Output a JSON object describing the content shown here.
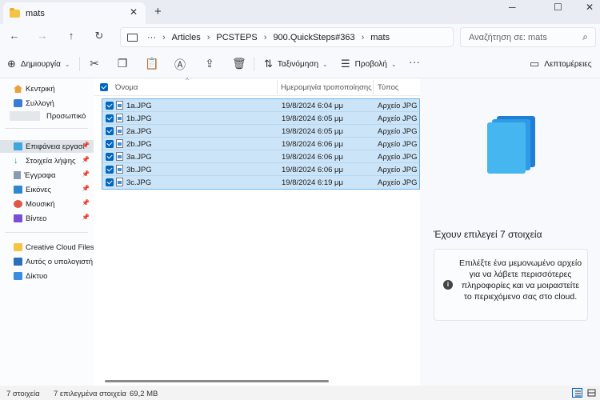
{
  "window": {
    "tab_title": "mats",
    "close_tab_glyph": "✕",
    "new_tab_glyph": "+",
    "minimize_glyph": "─",
    "maximize_glyph": "☐",
    "close_window_glyph": "✕"
  },
  "nav": {
    "back_glyph": "←",
    "forward_glyph": "→",
    "up_glyph": "↑",
    "refresh_glyph": "↻",
    "more_glyph": "···",
    "breadcrumb": [
      "Articles",
      "PCSTEPS",
      "900.QuickSteps#363",
      "mats"
    ],
    "separator": "›",
    "search_placeholder": "Αναζήτηση σε: mats",
    "search_icon": "search-icon"
  },
  "toolbar": {
    "new_label": "Δημιουργία",
    "sort_label": "Ταξινόμηση",
    "view_label": "Προβολή",
    "more_label": "···",
    "details_label": "Λεπτομέρειες",
    "icons": [
      "cut-icon",
      "copy-icon",
      "paste-icon",
      "rename-icon",
      "share-icon",
      "delete-icon"
    ]
  },
  "sidebar": {
    "items": [
      {
        "label": "Κεντρική",
        "icon": "home-icon",
        "pinned": false
      },
      {
        "label": "Συλλογή",
        "icon": "gallery-icon",
        "pinned": false
      },
      {
        "label": "Προσωπικό",
        "icon": "onedrive-icon",
        "pinned": false
      },
      {
        "label": "Επιφάνεια εργασί",
        "icon": "desktop-icon",
        "pinned": true
      },
      {
        "label": "Στοιχεία λήψης",
        "icon": "downloads-icon",
        "pinned": true
      },
      {
        "label": "Έγγραφα",
        "icon": "documents-icon",
        "pinned": true
      },
      {
        "label": "Εικόνες",
        "icon": "pictures-icon",
        "pinned": true
      },
      {
        "label": "Μουσική",
        "icon": "music-icon",
        "pinned": true
      },
      {
        "label": "Βίντεο",
        "icon": "videos-icon",
        "pinned": true
      },
      {
        "label": "Creative Cloud Files P",
        "icon": "creative-cloud-icon",
        "pinned": false
      },
      {
        "label": "Αυτός ο υπολογιστή",
        "icon": "this-pc-icon",
        "pinned": false
      },
      {
        "label": "Δίκτυο",
        "icon": "network-icon",
        "pinned": false
      }
    ],
    "pin_glyph": "📌"
  },
  "filelist": {
    "columns": {
      "name": "Όνομα",
      "date": "Ημερομηνία τροποποίησης",
      "type": "Τύπος"
    },
    "sort_glyph": "^",
    "rows": [
      {
        "name": "1a.JPG",
        "date": "19/8/2024 6:04 μμ",
        "type": "Αρχείο JPG"
      },
      {
        "name": "1b.JPG",
        "date": "19/8/2024 6:05 μμ",
        "type": "Αρχείο JPG"
      },
      {
        "name": "2a.JPG",
        "date": "19/8/2024 6:05 μμ",
        "type": "Αρχείο JPG"
      },
      {
        "name": "2b.JPG",
        "date": "19/8/2024 6:06 μμ",
        "type": "Αρχείο JPG"
      },
      {
        "name": "3a.JPG",
        "date": "19/8/2024 6:06 μμ",
        "type": "Αρχείο JPG"
      },
      {
        "name": "3b.JPG",
        "date": "19/8/2024 6:06 μμ",
        "type": "Αρχείο JPG"
      },
      {
        "name": "3c.JPG",
        "date": "19/8/2024 6:19 μμ",
        "type": "Αρχείο JPG"
      }
    ]
  },
  "details": {
    "selection_title": "Έχουν επιλεγεί 7 στοιχεία",
    "info_text": "Επιλέξτε ένα μεμονωμένο αρχείο για να λάβετε περισσότερες πληροφορίες και να μοιραστείτε το περιεχόμενο σας στο cloud.",
    "info_glyph": "i"
  },
  "status": {
    "count": "7 στοιχεία",
    "selected": "7 επιλεγμένα στοιχεία",
    "size": "69,2 MB"
  },
  "colors": {
    "accent": "#0067c0",
    "selection_bg": "#cce4f7",
    "selection_border": "#6fb2e8"
  }
}
